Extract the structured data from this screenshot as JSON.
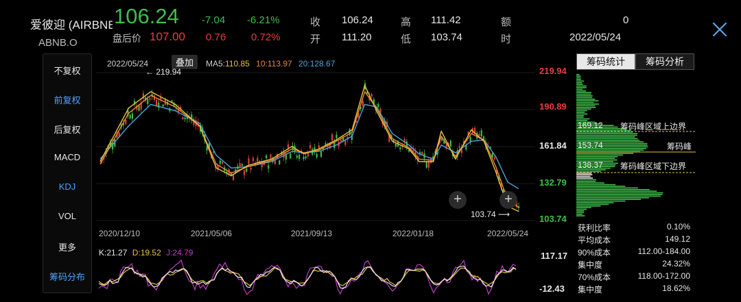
{
  "header": {
    "name": "爱彼迎 (AIRBNB",
    "ticker": "ABNB.O",
    "price": "106.24",
    "change": "-7.04",
    "change_pct": "-6.21%",
    "after_label": "盘后价",
    "after_price": "107.00",
    "after_change": "0.76",
    "after_change_pct": "0.72%",
    "close_label": "收",
    "close_value": "106.24",
    "high_label": "高",
    "high_value": "111.42",
    "amount_label": "额",
    "amount_value": "0",
    "open_label": "开",
    "open_value": "111.20",
    "low_label": "低",
    "low_value": "103.74",
    "time_label": "时",
    "time_value": "2022/05/24"
  },
  "left_menu": [
    "不复权",
    "前复权",
    "后复权",
    "MACD",
    "KDJ",
    "VOL",
    "更多",
    "筹码分布"
  ],
  "chart_header": {
    "date": "2022/05/24",
    "overlay_btn": "叠加",
    "ma5_label": "MA5:",
    "ma5_value": "110.85",
    "ma10_label": "10:",
    "ma10_value": "113.97",
    "ma20_label": "20:",
    "ma20_value": "128.67"
  },
  "price_axis": [
    "219.94",
    "190.89",
    "161.84",
    "132.79",
    "103.74"
  ],
  "annotations": {
    "high": "219.94",
    "low": "103.74"
  },
  "date_axis": [
    "2020/12/10",
    "2021/05/06",
    "2021/09/13",
    "2022/01/18",
    "2022/05/24"
  ],
  "kdj": {
    "k_label": "K:21.27",
    "d_label": "D:19.52",
    "j_label": "J:24.79",
    "axis_top": "117.17",
    "axis_bottom": "-12.43"
  },
  "chip": {
    "tab_stats": "筹码统计",
    "tab_analysis": "筹码分析",
    "upper_value": "169.12",
    "upper_label": "筹码峰区域上边界",
    "peak_value": "153.74",
    "peak_label": "筹码峰",
    "lower_value": "138.37",
    "lower_label": "筹码峰区域下边界",
    "stats": [
      {
        "label": "获利比率",
        "value": "0.10%"
      },
      {
        "label": "平均成本",
        "value": "149.12"
      },
      {
        "label": "90%成本",
        "value": "112.00-184.00"
      },
      {
        "label": "集中度",
        "value": "24.32%"
      },
      {
        "label": "70%成本",
        "value": "118.00-172.00"
      },
      {
        "label": "集中度",
        "value": "18.62%"
      }
    ]
  },
  "chart_data": {
    "type": "line",
    "title": "",
    "xlabel": "",
    "ylabel": "",
    "x_ticks": [
      "2020/12/10",
      "2021/05/06",
      "2021/09/13",
      "2022/01/18",
      "2022/05/24"
    ],
    "ylim": [
      103.74,
      219.94
    ],
    "series": [
      {
        "name": "MA5",
        "color": "#e8c340",
        "x": [
          "2020/12/10",
          "2021/01/15",
          "2021/02/12",
          "2021/03/15",
          "2021/04/15",
          "2021/05/06",
          "2021/05/25",
          "2021/06/15",
          "2021/07/15",
          "2021/08/10",
          "2021/08/25",
          "2021/09/13",
          "2021/10/05",
          "2021/10/25",
          "2021/11/10",
          "2021/11/25",
          "2021/12/15",
          "2022/01/05",
          "2022/01/18",
          "2022/02/05",
          "2022/02/15",
          "2022/03/05",
          "2022/03/25",
          "2022/04/10",
          "2022/04/25",
          "2022/05/10",
          "2022/05/24"
        ],
        "values": [
          150,
          192,
          205,
          195,
          178,
          145,
          139,
          147,
          152,
          162,
          156,
          160,
          167,
          175,
          210,
          190,
          166,
          160,
          150,
          150,
          174,
          152,
          175,
          166,
          142,
          115,
          110.85
        ]
      },
      {
        "name": "MA10",
        "color": "#e98a3c",
        "x": [
          "2020/12/10",
          "2021/01/15",
          "2021/02/12",
          "2021/03/15",
          "2021/04/15",
          "2021/05/06",
          "2021/05/25",
          "2021/06/15",
          "2021/07/15",
          "2021/08/10",
          "2021/08/25",
          "2021/09/13",
          "2021/10/05",
          "2021/10/25",
          "2021/11/10",
          "2021/11/25",
          "2021/12/15",
          "2022/01/05",
          "2022/01/18",
          "2022/02/05",
          "2022/02/15",
          "2022/03/05",
          "2022/03/25",
          "2022/04/10",
          "2022/04/25",
          "2022/05/10",
          "2022/05/24"
        ],
        "values": [
          148,
          188,
          202,
          193,
          178,
          148,
          141,
          146,
          151,
          160,
          157,
          159,
          166,
          173,
          205,
          192,
          168,
          161,
          152,
          151,
          170,
          154,
          172,
          167,
          146,
          120,
          113.97
        ]
      },
      {
        "name": "MA20",
        "color": "#4ea3dd",
        "x": [
          "2020/12/10",
          "2021/01/15",
          "2021/02/12",
          "2021/03/15",
          "2021/04/15",
          "2021/05/06",
          "2021/05/25",
          "2021/06/15",
          "2021/07/15",
          "2021/08/10",
          "2021/08/25",
          "2021/09/13",
          "2021/10/05",
          "2021/10/25",
          "2021/11/10",
          "2021/11/25",
          "2021/12/15",
          "2022/01/05",
          "2022/01/18",
          "2022/02/05",
          "2022/02/15",
          "2022/03/05",
          "2022/03/25",
          "2022/04/10",
          "2022/04/25",
          "2022/05/10",
          "2022/05/24"
        ],
        "values": [
          152,
          178,
          195,
          190,
          180,
          155,
          145,
          146,
          150,
          158,
          157,
          158,
          163,
          170,
          195,
          193,
          172,
          163,
          156,
          152,
          163,
          157,
          166,
          167,
          154,
          134,
          128.67
        ]
      }
    ]
  }
}
